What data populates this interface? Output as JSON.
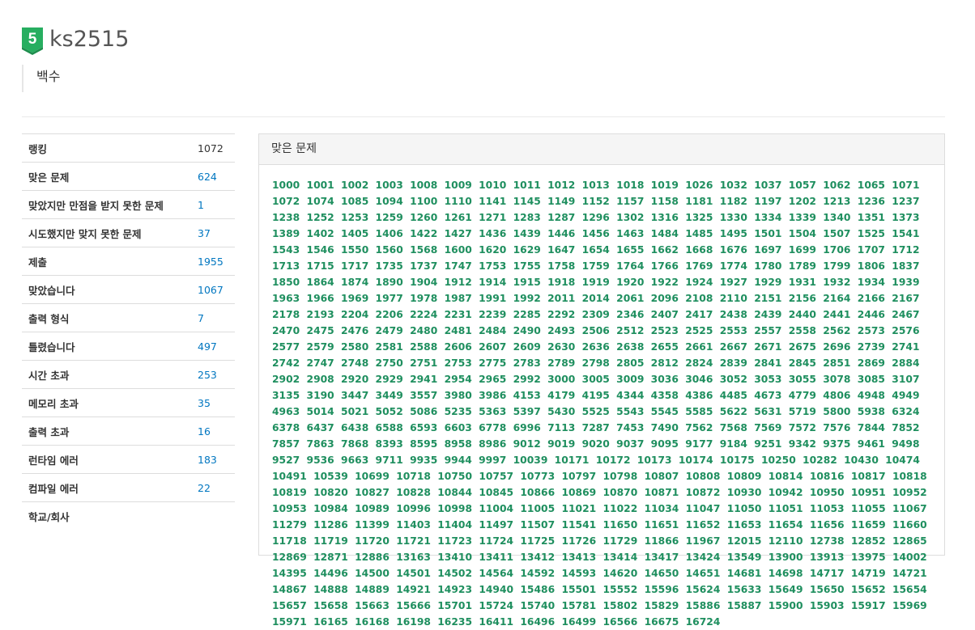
{
  "profile": {
    "tier_number": "5",
    "tier_color": "#27ae60",
    "username": "ks2515",
    "status_message": "백수"
  },
  "stats": [
    {
      "label": "랭킹",
      "value": "1072",
      "link": false
    },
    {
      "label": "맞은 문제",
      "value": "624",
      "link": true
    },
    {
      "label": "맞았지만 만점을 받지 못한 문제",
      "value": "1",
      "link": true
    },
    {
      "label": "시도했지만 맞지 못한 문제",
      "value": "37",
      "link": true
    },
    {
      "label": "제출",
      "value": "1955",
      "link": true
    },
    {
      "label": "맞았습니다",
      "value": "1067",
      "link": true
    },
    {
      "label": "출력 형식",
      "value": "7",
      "link": true
    },
    {
      "label": "틀렸습니다",
      "value": "497",
      "link": true
    },
    {
      "label": "시간 초과",
      "value": "253",
      "link": true
    },
    {
      "label": "메모리 초과",
      "value": "35",
      "link": true
    },
    {
      "label": "출력 초과",
      "value": "16",
      "link": true
    },
    {
      "label": "런타임 에러",
      "value": "183",
      "link": true
    },
    {
      "label": "컴파일 에러",
      "value": "22",
      "link": true
    },
    {
      "label": "학교/회사",
      "value": "",
      "link": false
    }
  ],
  "solved_panel": {
    "title": "맞은 문제",
    "link_color": "#1f8f5f",
    "problems": [
      "1000",
      "1001",
      "1002",
      "1003",
      "1008",
      "1009",
      "1010",
      "1011",
      "1012",
      "1013",
      "1018",
      "1019",
      "1026",
      "1032",
      "1037",
      "1057",
      "1062",
      "1065",
      "1071",
      "1072",
      "1074",
      "1085",
      "1094",
      "1100",
      "1110",
      "1141",
      "1145",
      "1149",
      "1152",
      "1157",
      "1158",
      "1181",
      "1182",
      "1197",
      "1202",
      "1213",
      "1236",
      "1237",
      "1238",
      "1252",
      "1253",
      "1259",
      "1260",
      "1261",
      "1271",
      "1283",
      "1287",
      "1296",
      "1302",
      "1316",
      "1325",
      "1330",
      "1334",
      "1339",
      "1340",
      "1351",
      "1373",
      "1389",
      "1402",
      "1405",
      "1406",
      "1422",
      "1427",
      "1436",
      "1439",
      "1446",
      "1456",
      "1463",
      "1484",
      "1485",
      "1495",
      "1501",
      "1504",
      "1507",
      "1525",
      "1541",
      "1543",
      "1546",
      "1550",
      "1560",
      "1568",
      "1600",
      "1620",
      "1629",
      "1647",
      "1654",
      "1655",
      "1662",
      "1668",
      "1676",
      "1697",
      "1699",
      "1706",
      "1707",
      "1712",
      "1713",
      "1715",
      "1717",
      "1735",
      "1737",
      "1747",
      "1753",
      "1755",
      "1758",
      "1759",
      "1764",
      "1766",
      "1769",
      "1774",
      "1780",
      "1789",
      "1799",
      "1806",
      "1837",
      "1850",
      "1864",
      "1874",
      "1890",
      "1904",
      "1912",
      "1914",
      "1915",
      "1918",
      "1919",
      "1920",
      "1922",
      "1924",
      "1927",
      "1929",
      "1931",
      "1932",
      "1934",
      "1939",
      "1963",
      "1966",
      "1969",
      "1977",
      "1978",
      "1987",
      "1991",
      "1992",
      "2011",
      "2014",
      "2061",
      "2096",
      "2108",
      "2110",
      "2151",
      "2156",
      "2164",
      "2166",
      "2167",
      "2178",
      "2193",
      "2204",
      "2206",
      "2224",
      "2231",
      "2239",
      "2285",
      "2292",
      "2309",
      "2346",
      "2407",
      "2417",
      "2438",
      "2439",
      "2440",
      "2441",
      "2446",
      "2467",
      "2470",
      "2475",
      "2476",
      "2479",
      "2480",
      "2481",
      "2484",
      "2490",
      "2493",
      "2506",
      "2512",
      "2523",
      "2525",
      "2553",
      "2557",
      "2558",
      "2562",
      "2573",
      "2576",
      "2577",
      "2579",
      "2580",
      "2581",
      "2588",
      "2606",
      "2607",
      "2609",
      "2630",
      "2636",
      "2638",
      "2655",
      "2661",
      "2667",
      "2671",
      "2675",
      "2696",
      "2739",
      "2741",
      "2742",
      "2747",
      "2748",
      "2750",
      "2751",
      "2753",
      "2775",
      "2783",
      "2789",
      "2798",
      "2805",
      "2812",
      "2824",
      "2839",
      "2841",
      "2845",
      "2851",
      "2869",
      "2884",
      "2902",
      "2908",
      "2920",
      "2929",
      "2941",
      "2954",
      "2965",
      "2992",
      "3000",
      "3005",
      "3009",
      "3036",
      "3046",
      "3052",
      "3053",
      "3055",
      "3078",
      "3085",
      "3107",
      "3135",
      "3190",
      "3447",
      "3449",
      "3557",
      "3980",
      "3986",
      "4153",
      "4179",
      "4195",
      "4344",
      "4358",
      "4386",
      "4485",
      "4673",
      "4779",
      "4806",
      "4948",
      "4949",
      "4963",
      "5014",
      "5021",
      "5052",
      "5086",
      "5235",
      "5363",
      "5397",
      "5430",
      "5525",
      "5543",
      "5545",
      "5585",
      "5622",
      "5631",
      "5719",
      "5800",
      "5938",
      "6324",
      "6378",
      "6437",
      "6438",
      "6588",
      "6593",
      "6603",
      "6778",
      "6996",
      "7113",
      "7287",
      "7453",
      "7490",
      "7562",
      "7568",
      "7569",
      "7572",
      "7576",
      "7844",
      "7852",
      "7857",
      "7863",
      "7868",
      "8393",
      "8595",
      "8958",
      "8986",
      "9012",
      "9019",
      "9020",
      "9037",
      "9095",
      "9177",
      "9184",
      "9251",
      "9342",
      "9375",
      "9461",
      "9498",
      "9527",
      "9536",
      "9663",
      "9711",
      "9935",
      "9944",
      "9997",
      "10039",
      "10171",
      "10172",
      "10173",
      "10174",
      "10175",
      "10250",
      "10282",
      "10430",
      "10474",
      "10491",
      "10539",
      "10699",
      "10718",
      "10750",
      "10757",
      "10773",
      "10797",
      "10798",
      "10807",
      "10808",
      "10809",
      "10814",
      "10816",
      "10817",
      "10818",
      "10819",
      "10820",
      "10827",
      "10828",
      "10844",
      "10845",
      "10866",
      "10869",
      "10870",
      "10871",
      "10872",
      "10930",
      "10942",
      "10950",
      "10951",
      "10952",
      "10953",
      "10984",
      "10989",
      "10996",
      "10998",
      "11004",
      "11005",
      "11021",
      "11022",
      "11034",
      "11047",
      "11050",
      "11051",
      "11053",
      "11055",
      "11067",
      "11279",
      "11286",
      "11399",
      "11403",
      "11404",
      "11497",
      "11507",
      "11541",
      "11650",
      "11651",
      "11652",
      "11653",
      "11654",
      "11656",
      "11659",
      "11660",
      "11718",
      "11719",
      "11720",
      "11721",
      "11723",
      "11724",
      "11725",
      "11726",
      "11729",
      "11866",
      "11967",
      "12015",
      "12110",
      "12738",
      "12852",
      "12865",
      "12869",
      "12871",
      "12886",
      "13163",
      "13410",
      "13411",
      "13412",
      "13413",
      "13414",
      "13417",
      "13424",
      "13549",
      "13900",
      "13913",
      "13975",
      "14002",
      "14395",
      "14496",
      "14500",
      "14501",
      "14502",
      "14564",
      "14592",
      "14593",
      "14620",
      "14650",
      "14651",
      "14681",
      "14698",
      "14717",
      "14719",
      "14721",
      "14867",
      "14888",
      "14889",
      "14921",
      "14923",
      "14940",
      "15486",
      "15501",
      "15552",
      "15596",
      "15624",
      "15633",
      "15649",
      "15650",
      "15652",
      "15654",
      "15657",
      "15658",
      "15663",
      "15666",
      "15701",
      "15724",
      "15740",
      "15781",
      "15802",
      "15829",
      "15886",
      "15887",
      "15900",
      "15903",
      "15917",
      "15969",
      "15971",
      "16165",
      "16168",
      "16198",
      "16235",
      "16411",
      "16496",
      "16499",
      "16566",
      "16675",
      "16724"
    ]
  }
}
